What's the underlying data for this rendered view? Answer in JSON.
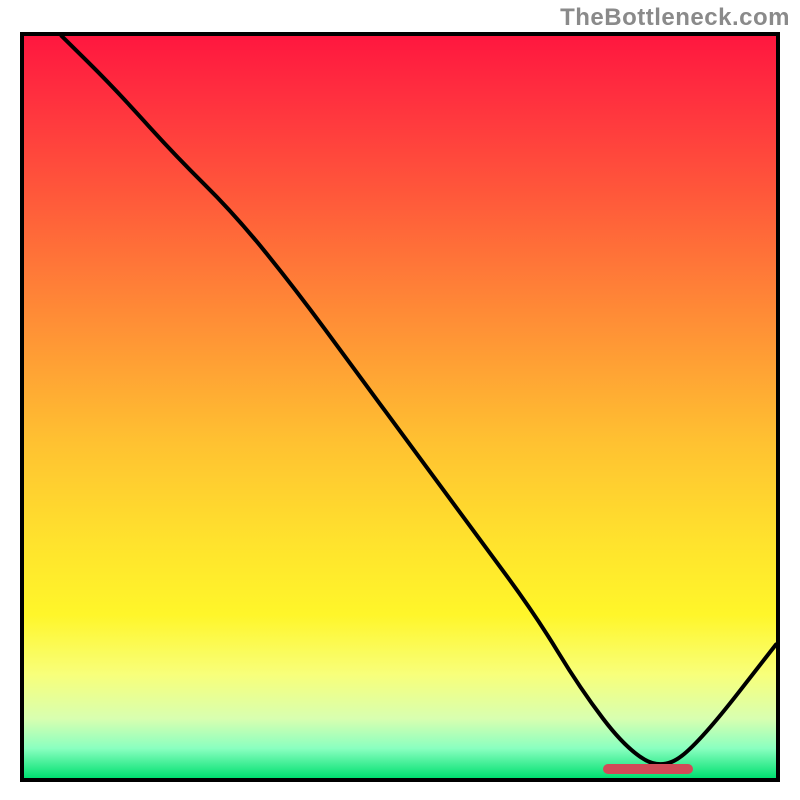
{
  "watermark": "TheBottleneck.com",
  "chart_data": {
    "type": "line",
    "title": "",
    "xlabel": "",
    "ylabel": "",
    "xlim": [
      0,
      100
    ],
    "ylim": [
      0,
      100
    ],
    "grid": false,
    "background_gradient": {
      "stops": [
        {
          "pos": 0,
          "color": "#ff173f"
        },
        {
          "pos": 8,
          "color": "#ff2f3f"
        },
        {
          "pos": 22,
          "color": "#ff5a3a"
        },
        {
          "pos": 38,
          "color": "#ff8d36"
        },
        {
          "pos": 55,
          "color": "#ffc231"
        },
        {
          "pos": 68,
          "color": "#ffe22d"
        },
        {
          "pos": 78,
          "color": "#fff62a"
        },
        {
          "pos": 86,
          "color": "#f8ff7a"
        },
        {
          "pos": 92,
          "color": "#d8ffb0"
        },
        {
          "pos": 96,
          "color": "#8affc0"
        },
        {
          "pos": 100,
          "color": "#00e070"
        }
      ]
    },
    "series": [
      {
        "name": "bottleneck-curve",
        "color": "#000000",
        "x": [
          5,
          12,
          20,
          28,
          36,
          44,
          52,
          60,
          68,
          74,
          80,
          85,
          90,
          100
        ],
        "y": [
          100,
          93,
          84,
          76,
          66,
          55,
          44,
          33,
          22,
          12,
          4,
          1,
          5,
          18
        ]
      }
    ],
    "annotations": [
      {
        "name": "optimal-range-marker",
        "type": "band",
        "axis": "x",
        "from": 77,
        "to": 89,
        "y": 1.2,
        "color": "#d24a57"
      }
    ]
  }
}
